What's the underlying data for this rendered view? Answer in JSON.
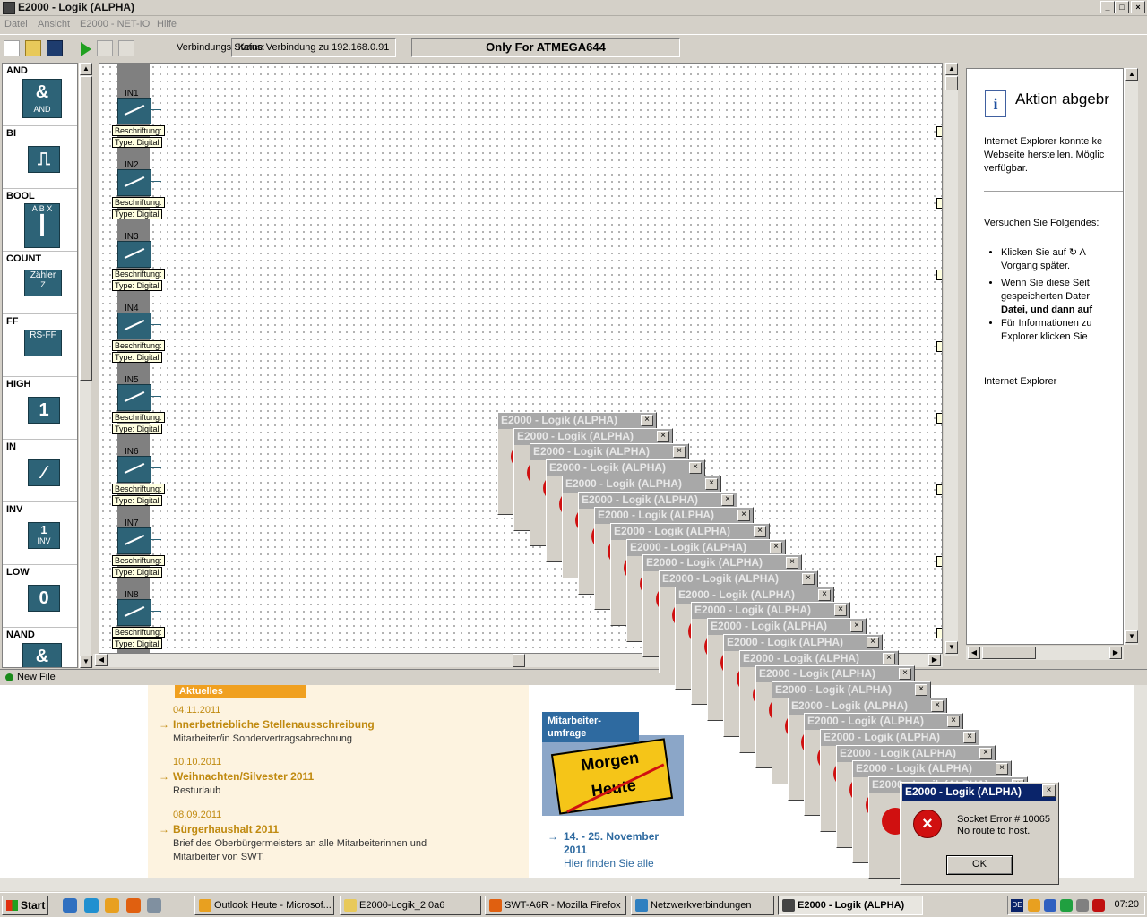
{
  "window": {
    "title": "E2000 - Logik (ALPHA)"
  },
  "menu": [
    "Datei",
    "Ansicht",
    "E2000 - NET-IO",
    "Hilfe"
  ],
  "toolbar": {
    "status_label": "Verbindungs Status:",
    "status_value": "Keine Verbindung zu 192.168.0.91",
    "target": "Only For ATMEGA644"
  },
  "palette": [
    {
      "label": "AND",
      "glyph": "&",
      "sub": "AND"
    },
    {
      "label": "BI",
      "glyph": "⎍",
      "sub": ""
    },
    {
      "label": "BOOL",
      "glyph": "┃",
      "sub": "A B X"
    },
    {
      "label": "COUNT",
      "glyph": "Zähler",
      "sub": "Z"
    },
    {
      "label": "FF",
      "glyph": "RS-FF",
      "sub": ""
    },
    {
      "label": "HIGH",
      "glyph": "1",
      "sub": ""
    },
    {
      "label": "IN",
      "glyph": "∕",
      "sub": ""
    },
    {
      "label": "INV",
      "glyph": "1",
      "sub": "INV"
    },
    {
      "label": "LOW",
      "glyph": "0",
      "sub": ""
    },
    {
      "label": "NAND",
      "glyph": "&",
      "sub": ""
    }
  ],
  "inputs": [
    {
      "name": "IN1",
      "caption": "Beschriftung:",
      "type": "Type: Digital"
    },
    {
      "name": "IN2",
      "caption": "Beschriftung:",
      "type": "Type: Digital"
    },
    {
      "name": "IN3",
      "caption": "Beschriftung:",
      "type": "Type: Digital"
    },
    {
      "name": "IN4",
      "caption": "Beschriftung:",
      "type": "Type: Digital"
    },
    {
      "name": "IN5",
      "caption": "Beschriftung:",
      "type": "Type: Digital"
    },
    {
      "name": "IN6",
      "caption": "Beschriftung:",
      "type": "Type: Digital"
    },
    {
      "name": "IN7",
      "caption": "Beschriftung:",
      "type": "Type: Digital"
    },
    {
      "name": "IN8",
      "caption": "Beschriftung:",
      "type": "Type: Digital"
    }
  ],
  "ie": {
    "heading": "Aktion abgebr",
    "p1": [
      "Internet Explorer konnte ke",
      "Webseite herstellen. Möglic",
      "verfügbar."
    ],
    "try": "Versuchen Sie Folgendes:",
    "bullets": [
      [
        "Klicken Sie auf ↻ A",
        "Vorgang später."
      ],
      [
        "Wenn Sie diese Seit",
        "gespeicherten Dater",
        "Datei, und dann auf"
      ],
      [
        "Für Informationen zu",
        "Explorer klicken Sie"
      ]
    ],
    "footer": "Internet Explorer"
  },
  "statusbar": {
    "text": "New File"
  },
  "website": {
    "news_header": "Aktuelles",
    "news": [
      {
        "date": "04.11.2011",
        "title": "Innerbetriebliche Stellenausschreibung",
        "text": [
          "Mitarbeiter/in Sondervertragsabrechnung"
        ]
      },
      {
        "date": "10.10.2011",
        "title": "Weihnachten/Silvester 2011",
        "text": [
          "Resturlaub"
        ]
      },
      {
        "date": "08.09.2011",
        "title": "Bürgerhaushalt 2011",
        "text": [
          "Brief des Oberbürgermeisters an alle Mitarbeiterinnen und",
          "Mitarbeiter von SWT."
        ]
      }
    ],
    "side_header": [
      "Mitarbeiter-",
      "umfrage"
    ],
    "sign_top": "Morgen",
    "sign_bottom": "Heute",
    "side_link": [
      "14. - 25. November",
      "2011"
    ],
    "side_sub": "Hier finden Sie alle"
  },
  "ghost_title": "E2000 - Logik (ALPHA)",
  "dialog": {
    "title": "E2000 - Logik (ALPHA)",
    "line1": "Socket Error # 10065",
    "line2": "No route to host.",
    "ok": "OK"
  },
  "taskbar": {
    "start": "Start",
    "tasks": [
      {
        "label": "Outlook Heute - Microsof...",
        "color": "#e8a020"
      },
      {
        "label": "E2000-Logik_2.0a6",
        "color": "#e8c95a"
      },
      {
        "label": "SWT-A6R - Mozilla Firefox",
        "color": "#e06010"
      },
      {
        "label": "Netzwerkverbindungen",
        "color": "#3080c0"
      },
      {
        "label": "E2000 - Logik (ALPHA)",
        "color": "#444444"
      }
    ],
    "lang": "DE",
    "clock": "07:20"
  }
}
